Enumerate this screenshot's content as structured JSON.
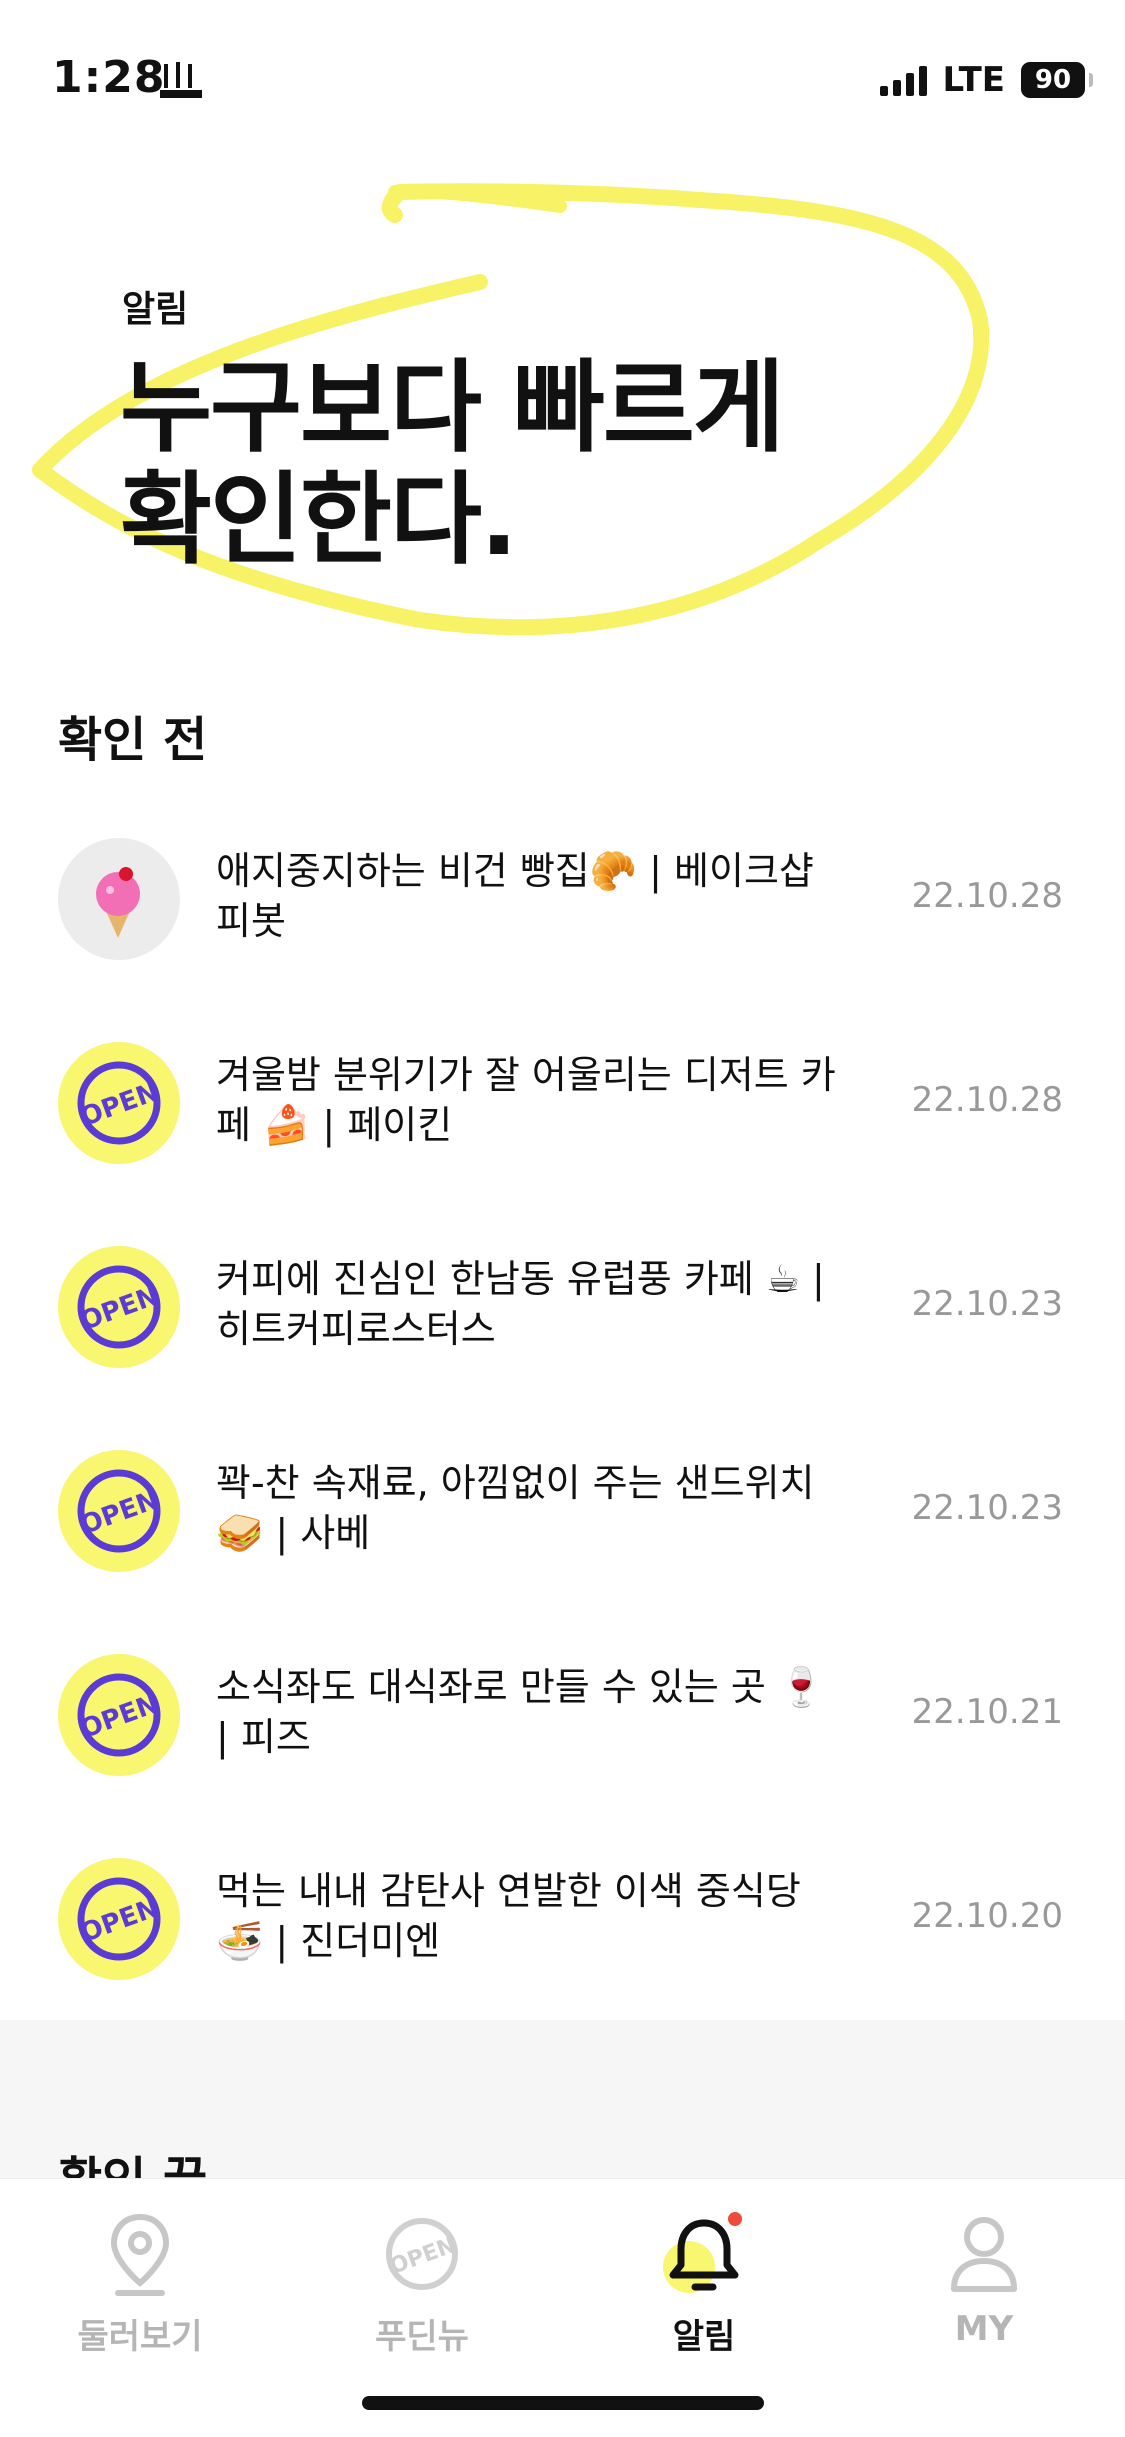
{
  "status_bar": {
    "time": "1:28",
    "network": "LTE",
    "battery": "90"
  },
  "hero": {
    "label": "알림",
    "title": "누구보다 빠르게\n확인한다."
  },
  "unread_section": {
    "title": "확인 전",
    "items": [
      {
        "text": "애지중지하는 비건 빵집🥐 | 베이크샵 피봇",
        "date": "22.10.28",
        "avatar": "ice-cream"
      },
      {
        "text": "겨울밤 분위기가 잘 어울리는 디저트 카페 🍰 | 페이킨",
        "date": "22.10.28",
        "avatar": "open"
      },
      {
        "text": "커피에 진심인 한남동 유럽풍 카페 ☕ | 히트커피로스터스",
        "date": "22.10.23",
        "avatar": "open"
      },
      {
        "text": "꽉-찬 속재료, 아낌없이 주는 샌드위치 🥪 | 사베",
        "date": "22.10.23",
        "avatar": "open"
      },
      {
        "text": "소식좌도 대식좌로 만들 수 있는 곳 🍷 | 피즈",
        "date": "22.10.21",
        "avatar": "open"
      },
      {
        "text": "먹는 내내 감탄사 연발한 이색 중식당 🍜 | 진더미엔",
        "date": "22.10.20",
        "avatar": "open"
      }
    ]
  },
  "read_section": {
    "title": "확인 끝"
  },
  "open_badge_text": "OPEN",
  "bottom_nav": {
    "items": [
      {
        "label": "둘러보기",
        "icon": "location-pin-icon"
      },
      {
        "label": "푸딘뉴",
        "icon": "open-badge-icon"
      },
      {
        "label": "알림",
        "icon": "bell-icon"
      },
      {
        "label": "MY",
        "icon": "person-icon"
      }
    ]
  },
  "colors": {
    "accent_yellow": "#f9f66f",
    "purple": "#5b3bd6",
    "notification_dot": "#f04a3c"
  }
}
